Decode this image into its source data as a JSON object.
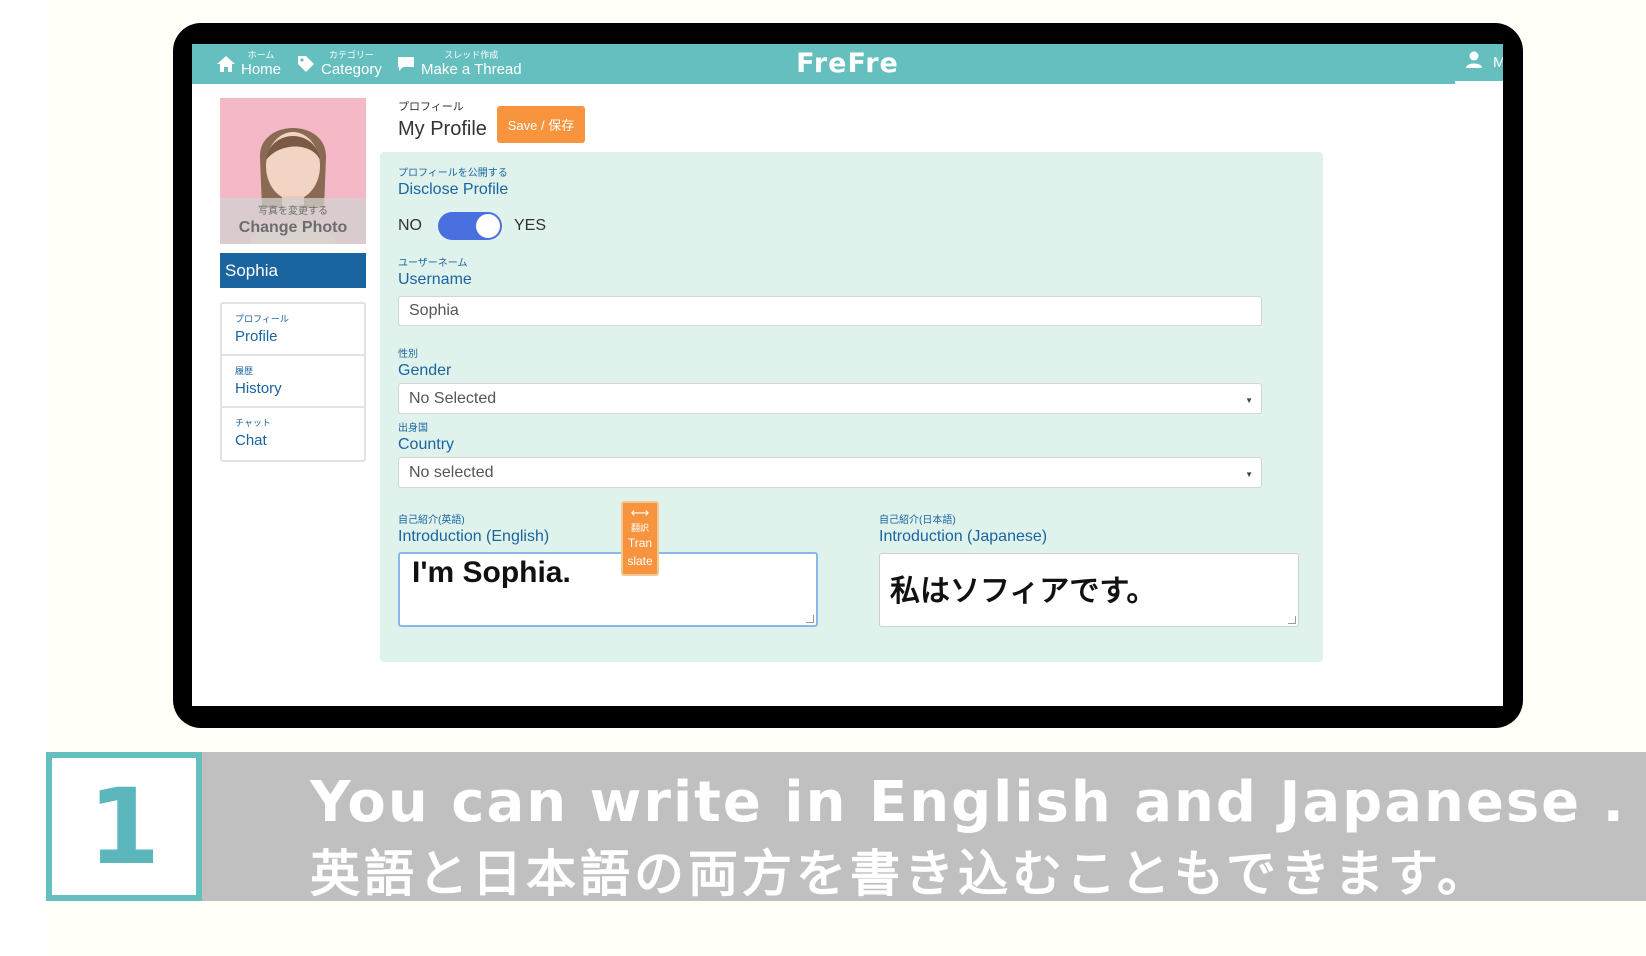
{
  "nav": {
    "home": {
      "sub": "ホーム",
      "label": "Home"
    },
    "category": {
      "sub": "カテゴリー",
      "label": "Category"
    },
    "thread": {
      "sub": "スレッド作成",
      "label": "Make a Thread"
    },
    "brand": "FreFre",
    "user_initial": "M"
  },
  "sidebar": {
    "photo_sub": "写真を変更する",
    "photo_label": "Change Photo",
    "username": "Sophia",
    "items": [
      {
        "sub": "プロフィール",
        "label": "Profile"
      },
      {
        "sub": "履歴",
        "label": "History"
      },
      {
        "sub": "チャット",
        "label": "Chat"
      }
    ]
  },
  "header": {
    "sub": "プロフィール",
    "title": "My Profile",
    "save_label": "Save / 保存"
  },
  "form": {
    "disclose": {
      "sub": "プロフィールを公開する",
      "label": "Disclose Profile",
      "no": "NO",
      "yes": "YES",
      "value": true
    },
    "username": {
      "sub": "ユーザーネーム",
      "label": "Username",
      "value": "Sophia"
    },
    "gender": {
      "sub": "性別",
      "label": "Gender",
      "value": "No Selected"
    },
    "country": {
      "sub": "出身国",
      "label": "Country",
      "value": "No selected"
    },
    "intro_en": {
      "sub": "自己紹介(英語)",
      "label": "Introduction (English)",
      "value": "I'm Sophia."
    },
    "intro_ja": {
      "sub": "自己紹介(日本語)",
      "label": "Introduction (Japanese)",
      "value": "私はソフィアです。"
    },
    "translate": {
      "arrow": "⟷",
      "jp": "翻訳",
      "line1": "Tran",
      "line2": "slate"
    }
  },
  "banner": {
    "number": "1",
    "line1": "You can write in English and Japanese .",
    "line2": "英語と日本語の両方を書き込むこともできます。"
  },
  "colors": {
    "nav": "#66bfbf",
    "accent": "#f7943d",
    "link": "#1a64a0",
    "panel": "#dff3ec",
    "banner": "#c0c0c0"
  }
}
